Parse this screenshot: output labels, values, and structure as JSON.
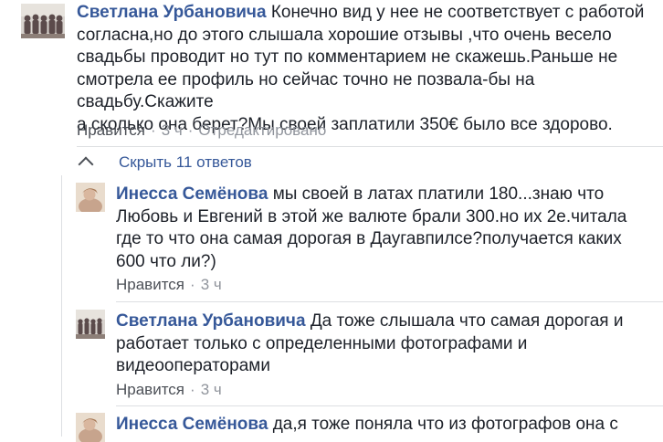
{
  "comments": [
    {
      "author": "Светлана Урбановича",
      "lines": [
        "Конечно вид у нее не соответствует с работой",
        "согласна,но до этого слышала хорошие отзывы ,что очень весело",
        "свадьбы проводит но тут по комментарием не скажешь.Раньше не",
        "смотрела ее профиль но сейчас точно не позвала-бы на свадьбу.Скажите",
        "а сколько она берет?Мы своей заплатили 350€ было все здорово."
      ],
      "like_label": "Нравится",
      "time": "3 ч",
      "edited": "Отредактировано"
    }
  ],
  "hide_replies_label": "Скрыть 11 ответов",
  "replies": [
    {
      "author": "Инесса Семёнова",
      "lines": [
        "мы своей в латах платили 180...знаю что",
        "Любовь и Евгений в этой же валюте брали 300.но их 2е.читала",
        "где то что она самая дорогая в Даугавпилсе?получается каких",
        "600 что ли?)"
      ],
      "like_label": "Нравится",
      "time": "3 ч"
    },
    {
      "author": "Светлана Урбановича",
      "lines": [
        "Да тоже слышала что самая дорогая и",
        "работает только с определенными фотографами и",
        "видеооператорами"
      ],
      "like_label": "Нравится",
      "time": "3 ч"
    },
    {
      "author": "Инесса Семёнова",
      "lines": [
        "да,я тоже поняла что из фотографов она с"
      ]
    }
  ],
  "colors": {
    "author": "#365899",
    "text": "#1d2129",
    "meta": "#90949c",
    "like": "#4b4f56"
  },
  "icons": {
    "hide_replies": "chevron-up-icon"
  }
}
